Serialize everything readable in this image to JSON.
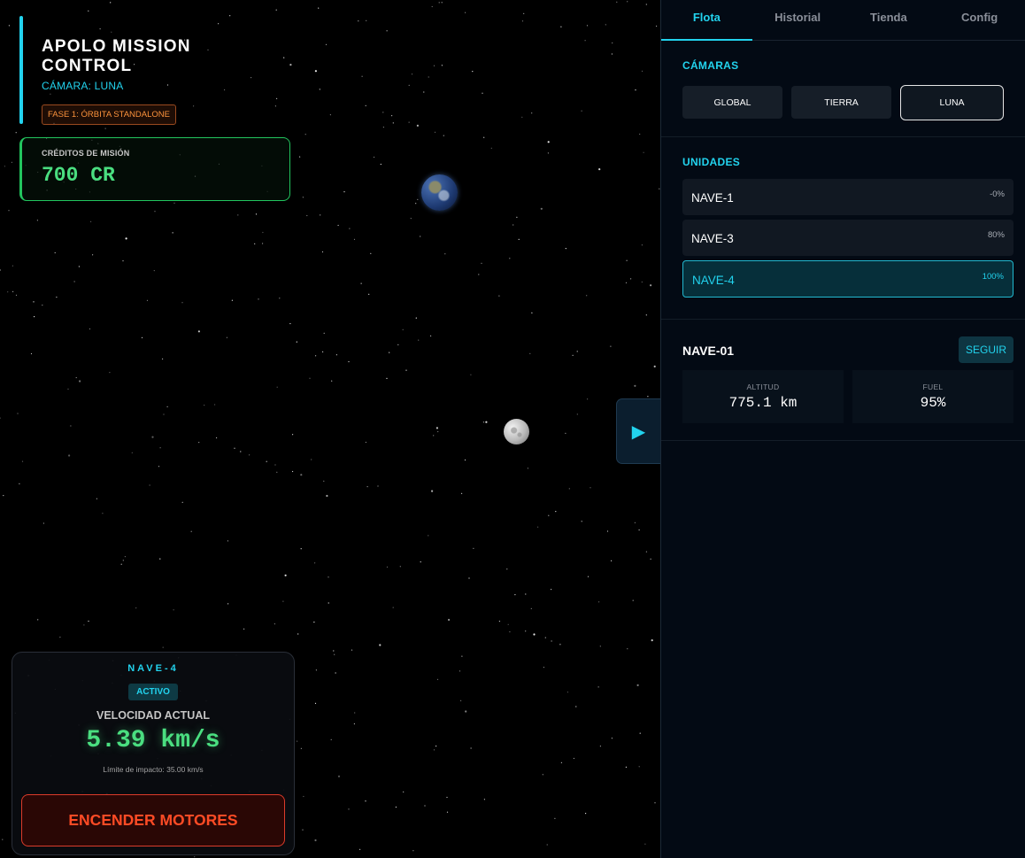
{
  "header": {
    "title": "APOLO MISSION CONTROL",
    "camera": "CÁMARA: LUNA",
    "phase": "FASE 1: ÓRBITA STANDALONE"
  },
  "credits": {
    "label": "CRÉDITOS DE MISIÓN",
    "value": "700 CR"
  },
  "ship_card": {
    "name": "NAVE-4",
    "status": "ACTIVO",
    "speed_label": "VELOCIDAD ACTUAL",
    "speed_value": "5.39 km/s",
    "impact_limit": "Límite de impacto: 35.00 km/s",
    "engine_button": "ENCENDER MOTORES"
  },
  "toggle_icon": "play-right-icon",
  "tabs": [
    {
      "label": "Flota",
      "active": true
    },
    {
      "label": "Historial",
      "active": false
    },
    {
      "label": "Tienda",
      "active": false
    },
    {
      "label": "Config",
      "active": false
    }
  ],
  "cameras": {
    "title": "CÁMARAS",
    "buttons": [
      "GLOBAL",
      "TIERRA",
      "LUNA"
    ],
    "selected": "LUNA"
  },
  "units": {
    "title": "UNIDADES",
    "items": [
      {
        "name": "NAVE-1",
        "pct": "-0%"
      },
      {
        "name": "NAVE-3",
        "pct": "80%"
      },
      {
        "name": "NAVE-4",
        "pct": "100%"
      }
    ],
    "selected": "NAVE-4"
  },
  "detail": {
    "name": "NAVE-01",
    "follow_label": "SEGUIR",
    "stats": [
      {
        "label": "ALTITUD",
        "value": "775.1 km"
      },
      {
        "label": "FUEL",
        "value": "95%"
      }
    ]
  },
  "colors": {
    "accent": "#22d3ee",
    "credits": "#4ade80",
    "engine": "#ff4b25",
    "phase": "#fb923c"
  }
}
